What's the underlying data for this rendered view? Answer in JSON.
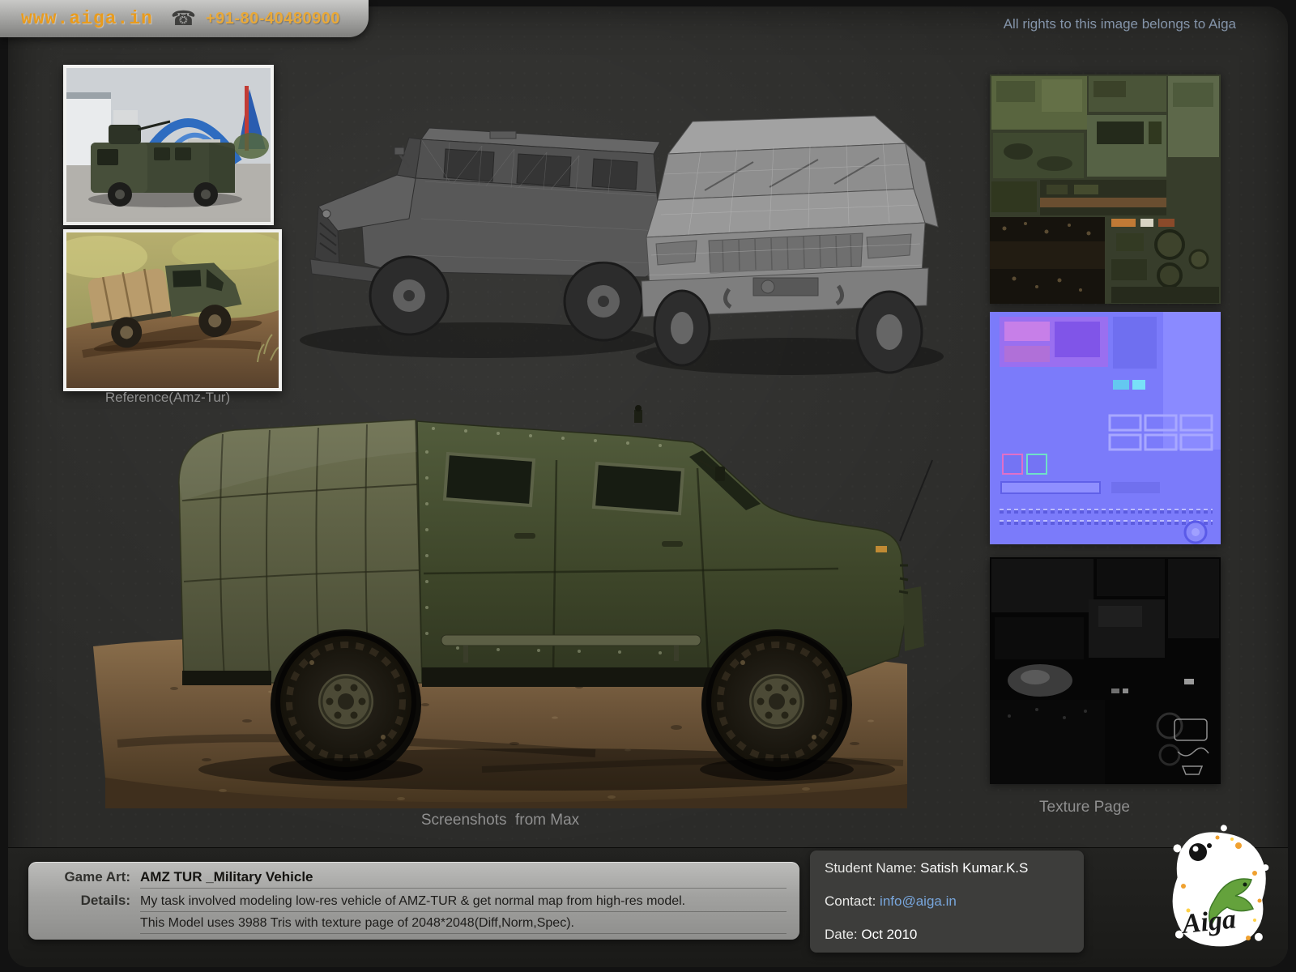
{
  "header": {
    "website": "www.aiga.in",
    "phone_number": "+91-80-40480900",
    "rights_notice": "All rights to this image belongs to Aiga"
  },
  "icons": {
    "phone": "☎"
  },
  "sections": {
    "reference_caption": "Reference(Amz-Tur)",
    "screenshots_caption": "Screenshots  from Max",
    "texture_caption": "Texture Page"
  },
  "info_bar": {
    "game_art_label": "Game Art:",
    "game_art_title": "AMZ TUR _Military Vehicle",
    "details_label": "Details:",
    "details_line1": "My task involved modeling low-res vehicle of AMZ-TUR & get normal map from high-res model.",
    "details_line2": "This Model uses 3988 Tris with texture page of 2048*2048(Diff,Norm,Spec)."
  },
  "student_info": {
    "name_label": "Student Name:",
    "name_value": "Satish Kumar.K.S",
    "contact_label": "Contact:",
    "contact_value": "info@aiga.in",
    "date_label": "Date:",
    "date_value": "Oct 2010"
  },
  "logo": {
    "text": "Aiga"
  },
  "colors": {
    "page_background": "#1a1a1a",
    "panel_background": "#2b2b29",
    "accent_orange": "#e89b1e",
    "phone_gold": "#e8a93a",
    "link_blue": "#78a6dc",
    "caption_gray": "#8f8f8f",
    "rights_blue_gray": "#8494a9",
    "normal_map_purple": "#7b7bfa",
    "vehicle_green": "#49503a"
  }
}
